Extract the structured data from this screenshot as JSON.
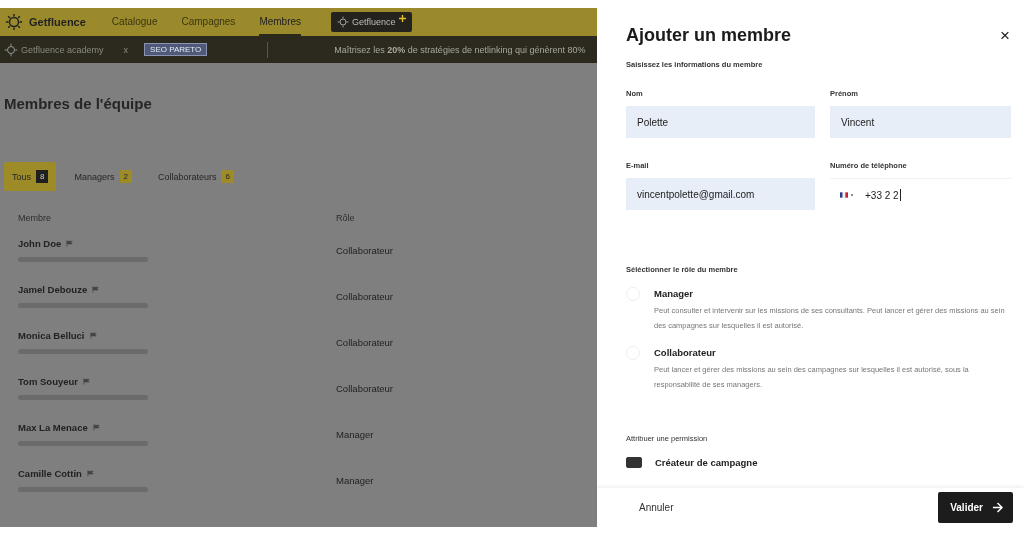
{
  "nav": {
    "brand": "Getfluence",
    "items": [
      {
        "label": "Catalogue",
        "selected": false
      },
      {
        "label": "Campagnes",
        "selected": false
      },
      {
        "label": "Membres",
        "selected": true
      }
    ],
    "plus_button": "Getfluence"
  },
  "academy_bar": {
    "brand": "Getfluence academy",
    "separator": "x",
    "badge": "SEO PARETO",
    "message": "Maîtrisez les **20%** de stratégies de netlinking qui génèrent 80%"
  },
  "page": {
    "title": "Membres de l'équipe",
    "tabs": [
      {
        "label": "Tous",
        "count": "8",
        "selected": true
      },
      {
        "label": "Managers",
        "count": "2",
        "selected": false
      },
      {
        "label": "Collaborateurs",
        "count": "6",
        "selected": false
      }
    ],
    "table": {
      "columns": [
        "Membre",
        "Rôle"
      ],
      "rows": [
        {
          "name": "John Doe",
          "role": "Collaborateur"
        },
        {
          "name": "Jamel Debouze",
          "role": "Collaborateur"
        },
        {
          "name": "Monica Belluci",
          "role": "Collaborateur"
        },
        {
          "name": "Tom Souyeur",
          "role": "Collaborateur"
        },
        {
          "name": "Max La Menace",
          "role": "Manager"
        },
        {
          "name": "Camille Cottin",
          "role": "Manager"
        }
      ]
    }
  },
  "drawer": {
    "title": "Ajouter un membre",
    "close": "×",
    "subtitle": "Saisissez les informations du membre",
    "fields": [
      {
        "label": "Nom",
        "value": "Polette"
      },
      {
        "label": "Prénom",
        "value": "Vincent"
      },
      {
        "label": "E-mail",
        "value": "vincentpolette@gmail.com"
      }
    ],
    "phone": {
      "label": "Numéro de téléphone",
      "value": "+33 2 2"
    },
    "role_section": "Séléctionner le rôle du membre",
    "roles": [
      {
        "name": "Manager",
        "description": "Peut consulter et intervenir sur les missions de ses consultants. Peut lancer et gérer des missions au sein des campagnes sur lesquelles il est autorisé.",
        "selected": false
      },
      {
        "name": "Collaborateur",
        "description": "Peut lancer et gérer des missions au sein des campagnes sur lesquelles il est autorisé, sous la responsabilité de ses managers.",
        "selected": false
      }
    ],
    "permission_section": "Attribuer une permission",
    "permissions": [
      {
        "label": "Créateur de campagne",
        "checked": true
      }
    ],
    "cancel": "Annuler",
    "submit": "Valider"
  }
}
